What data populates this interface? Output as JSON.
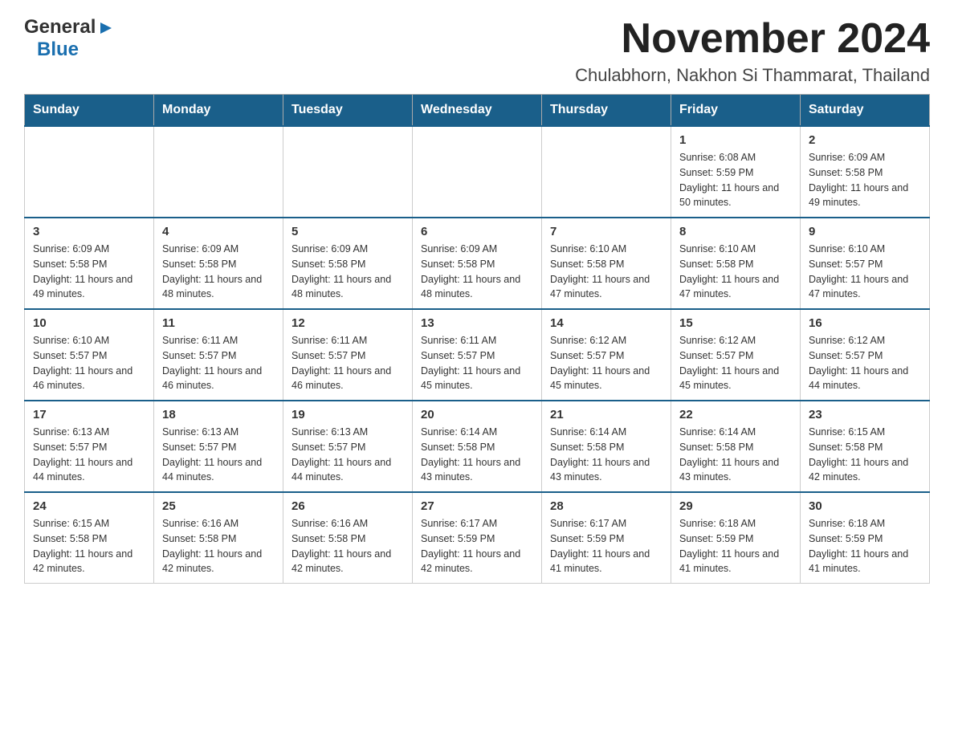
{
  "logo": {
    "general": "General",
    "blue": "Blue"
  },
  "header": {
    "month_title": "November 2024",
    "subtitle": "Chulabhorn, Nakhon Si Thammarat, Thailand"
  },
  "days_of_week": [
    "Sunday",
    "Monday",
    "Tuesday",
    "Wednesday",
    "Thursday",
    "Friday",
    "Saturday"
  ],
  "weeks": [
    [
      {
        "day": "",
        "info": ""
      },
      {
        "day": "",
        "info": ""
      },
      {
        "day": "",
        "info": ""
      },
      {
        "day": "",
        "info": ""
      },
      {
        "day": "",
        "info": ""
      },
      {
        "day": "1",
        "info": "Sunrise: 6:08 AM\nSunset: 5:59 PM\nDaylight: 11 hours and 50 minutes."
      },
      {
        "day": "2",
        "info": "Sunrise: 6:09 AM\nSunset: 5:58 PM\nDaylight: 11 hours and 49 minutes."
      }
    ],
    [
      {
        "day": "3",
        "info": "Sunrise: 6:09 AM\nSunset: 5:58 PM\nDaylight: 11 hours and 49 minutes."
      },
      {
        "day": "4",
        "info": "Sunrise: 6:09 AM\nSunset: 5:58 PM\nDaylight: 11 hours and 48 minutes."
      },
      {
        "day": "5",
        "info": "Sunrise: 6:09 AM\nSunset: 5:58 PM\nDaylight: 11 hours and 48 minutes."
      },
      {
        "day": "6",
        "info": "Sunrise: 6:09 AM\nSunset: 5:58 PM\nDaylight: 11 hours and 48 minutes."
      },
      {
        "day": "7",
        "info": "Sunrise: 6:10 AM\nSunset: 5:58 PM\nDaylight: 11 hours and 47 minutes."
      },
      {
        "day": "8",
        "info": "Sunrise: 6:10 AM\nSunset: 5:58 PM\nDaylight: 11 hours and 47 minutes."
      },
      {
        "day": "9",
        "info": "Sunrise: 6:10 AM\nSunset: 5:57 PM\nDaylight: 11 hours and 47 minutes."
      }
    ],
    [
      {
        "day": "10",
        "info": "Sunrise: 6:10 AM\nSunset: 5:57 PM\nDaylight: 11 hours and 46 minutes."
      },
      {
        "day": "11",
        "info": "Sunrise: 6:11 AM\nSunset: 5:57 PM\nDaylight: 11 hours and 46 minutes."
      },
      {
        "day": "12",
        "info": "Sunrise: 6:11 AM\nSunset: 5:57 PM\nDaylight: 11 hours and 46 minutes."
      },
      {
        "day": "13",
        "info": "Sunrise: 6:11 AM\nSunset: 5:57 PM\nDaylight: 11 hours and 45 minutes."
      },
      {
        "day": "14",
        "info": "Sunrise: 6:12 AM\nSunset: 5:57 PM\nDaylight: 11 hours and 45 minutes."
      },
      {
        "day": "15",
        "info": "Sunrise: 6:12 AM\nSunset: 5:57 PM\nDaylight: 11 hours and 45 minutes."
      },
      {
        "day": "16",
        "info": "Sunrise: 6:12 AM\nSunset: 5:57 PM\nDaylight: 11 hours and 44 minutes."
      }
    ],
    [
      {
        "day": "17",
        "info": "Sunrise: 6:13 AM\nSunset: 5:57 PM\nDaylight: 11 hours and 44 minutes."
      },
      {
        "day": "18",
        "info": "Sunrise: 6:13 AM\nSunset: 5:57 PM\nDaylight: 11 hours and 44 minutes."
      },
      {
        "day": "19",
        "info": "Sunrise: 6:13 AM\nSunset: 5:57 PM\nDaylight: 11 hours and 44 minutes."
      },
      {
        "day": "20",
        "info": "Sunrise: 6:14 AM\nSunset: 5:58 PM\nDaylight: 11 hours and 43 minutes."
      },
      {
        "day": "21",
        "info": "Sunrise: 6:14 AM\nSunset: 5:58 PM\nDaylight: 11 hours and 43 minutes."
      },
      {
        "day": "22",
        "info": "Sunrise: 6:14 AM\nSunset: 5:58 PM\nDaylight: 11 hours and 43 minutes."
      },
      {
        "day": "23",
        "info": "Sunrise: 6:15 AM\nSunset: 5:58 PM\nDaylight: 11 hours and 42 minutes."
      }
    ],
    [
      {
        "day": "24",
        "info": "Sunrise: 6:15 AM\nSunset: 5:58 PM\nDaylight: 11 hours and 42 minutes."
      },
      {
        "day": "25",
        "info": "Sunrise: 6:16 AM\nSunset: 5:58 PM\nDaylight: 11 hours and 42 minutes."
      },
      {
        "day": "26",
        "info": "Sunrise: 6:16 AM\nSunset: 5:58 PM\nDaylight: 11 hours and 42 minutes."
      },
      {
        "day": "27",
        "info": "Sunrise: 6:17 AM\nSunset: 5:59 PM\nDaylight: 11 hours and 42 minutes."
      },
      {
        "day": "28",
        "info": "Sunrise: 6:17 AM\nSunset: 5:59 PM\nDaylight: 11 hours and 41 minutes."
      },
      {
        "day": "29",
        "info": "Sunrise: 6:18 AM\nSunset: 5:59 PM\nDaylight: 11 hours and 41 minutes."
      },
      {
        "day": "30",
        "info": "Sunrise: 6:18 AM\nSunset: 5:59 PM\nDaylight: 11 hours and 41 minutes."
      }
    ]
  ]
}
